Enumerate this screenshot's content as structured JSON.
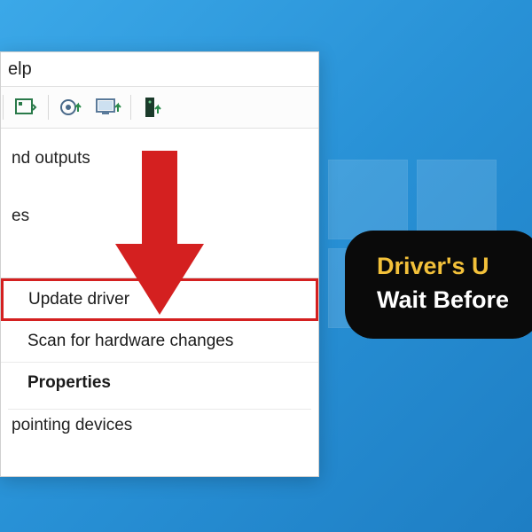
{
  "menubar": {
    "help": "elp"
  },
  "tree": {
    "item1": "nd outputs",
    "item2": "es",
    "item3": "pointing devices"
  },
  "context": {
    "update": "Update driver",
    "scan": "Scan for hardware changes",
    "properties": "Properties"
  },
  "caption": {
    "line1": "Driver's U",
    "line2": "Wait Before"
  }
}
